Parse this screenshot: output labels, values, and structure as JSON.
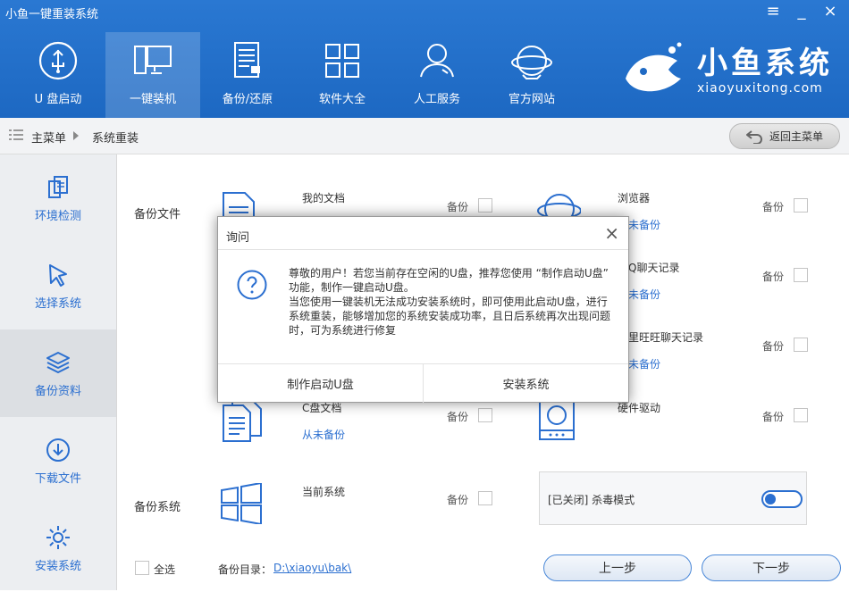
{
  "window": {
    "title": "小鱼一键重装系统",
    "controls": [
      {
        "name": "menu-button",
        "glyph": "≡"
      },
      {
        "name": "minimize-button",
        "glyph": "_"
      },
      {
        "name": "close-button",
        "glyph": "×"
      }
    ]
  },
  "nav": {
    "items": [
      {
        "label": "U 盘启动",
        "icon": "usb-icon"
      },
      {
        "label": "一键装机",
        "icon": "monitor-icon",
        "active": true
      },
      {
        "label": "备份/还原",
        "icon": "backup-icon"
      },
      {
        "label": "软件大全",
        "icon": "grid-icon"
      },
      {
        "label": "人工服务",
        "icon": "person-icon"
      },
      {
        "label": "官方网站",
        "icon": "globe-icon"
      }
    ]
  },
  "brand": {
    "name_cn": "小鱼系统",
    "name_en": "xiaoyuxitong.com"
  },
  "breadcrumb": {
    "main": "主菜单",
    "current": "系统重装",
    "back_label": "返回主菜单"
  },
  "sidebar": {
    "items": [
      {
        "label": "环境检测",
        "icon": "environment-check-icon"
      },
      {
        "label": "选择系统",
        "icon": "cursor-icon"
      },
      {
        "label": "备份资料",
        "icon": "layers-icon",
        "active": true
      },
      {
        "label": "下载文件",
        "icon": "download-icon"
      },
      {
        "label": "安装系统",
        "icon": "gear-icon"
      }
    ]
  },
  "backup": {
    "files_section": "备份文件",
    "system_section": "备份系统",
    "backup_label": "备份",
    "items": {
      "my_docs": {
        "title": "我的文档"
      },
      "browser": {
        "title": "浏览器",
        "status": "未备份"
      },
      "qq": {
        "title": "Q聊天记录",
        "status": "未备份"
      },
      "aliww": {
        "title": "里旺旺聊天记录",
        "status": "未备份"
      },
      "c_docs": {
        "title": "C盘文档",
        "status": "从未备份"
      },
      "drivers": {
        "title": "硬件驱动"
      },
      "current_system": {
        "title": "当前系统"
      }
    },
    "antivirus": {
      "label": "[已关闭] 杀毒模式",
      "on": false
    },
    "select_all": "全选",
    "dir_label": "备份目录：",
    "dir_path": "D:\\xiaoyu\\bak\\",
    "prev": "上一步",
    "next": "下一步"
  },
  "dialog": {
    "title": "询问",
    "close": "×",
    "line1": "尊敬的用户！若您当前存在空闲的U盘，推荐您使用 “制作启动U盘” 功能，制作一键启动U盘。",
    "line2": "当您使用一键装机无法成功安装系统时，即可使用此启动U盘，进行系统重装，能够增加您的系统安装成功率，且日后系统再次出现问题时，可为系统进行修复",
    "btn_make_usb": "制作启动U盘",
    "btn_install": "安装系统"
  },
  "colors": {
    "header": "#1f6ac4",
    "accent": "#2b6fd0",
    "sidebar_bg": "#eceef1"
  }
}
